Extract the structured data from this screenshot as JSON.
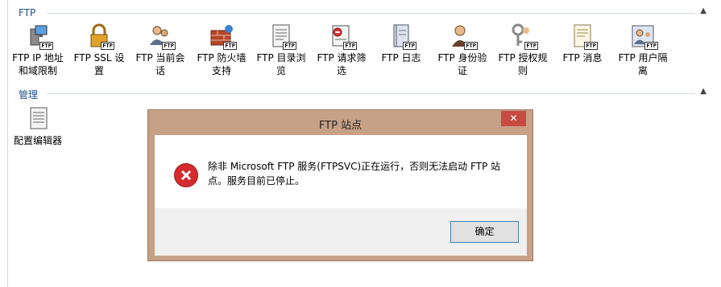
{
  "sections": {
    "ftp": {
      "title": "FTP"
    },
    "manage": {
      "title": "管理"
    }
  },
  "features": [
    {
      "icon": "ip-restrictions-icon",
      "line1": "FTP IP 地址",
      "line2": "和域限制"
    },
    {
      "icon": "ssl-settings-icon",
      "line1": "FTP SSL 设",
      "line2": "置"
    },
    {
      "icon": "current-sessions-icon",
      "line1": "FTP 当前会",
      "line2": "话"
    },
    {
      "icon": "firewall-support-icon",
      "line1": "FTP 防火墙",
      "line2": "支持"
    },
    {
      "icon": "directory-browsing-icon",
      "line1": "FTP 目录浏",
      "line2": "览"
    },
    {
      "icon": "request-filtering-icon",
      "line1": "FTP 请求筛",
      "line2": "选"
    },
    {
      "icon": "logging-icon",
      "line1": "FTP 日志",
      "line2": ""
    },
    {
      "icon": "authentication-icon",
      "line1": "FTP 身份验",
      "line2": "证"
    },
    {
      "icon": "authorization-rules-icon",
      "line1": "FTP 授权规",
      "line2": "则"
    },
    {
      "icon": "messages-icon",
      "line1": "FTP 消息",
      "line2": ""
    },
    {
      "icon": "user-isolation-icon",
      "line1": "FTP 用户隔",
      "line2": "离"
    }
  ],
  "badge": "FTP",
  "manage_items": [
    {
      "icon": "config-editor-icon",
      "label": "配置编辑器"
    }
  ],
  "dialog": {
    "title": "FTP 站点",
    "close_glyph": "✕",
    "message_line1": "除非 Microsoft FTP 服务(FTPSVC)正在运行，否则无法启动 FTP 站",
    "message_line2": "点。服务目前已停止。",
    "ok_label": "确定"
  },
  "colors": {
    "dialog_frame": "#c7a186",
    "close_button": "#c74a43",
    "error_icon": "#d42c2c",
    "section_title": "#1f4e8c"
  }
}
